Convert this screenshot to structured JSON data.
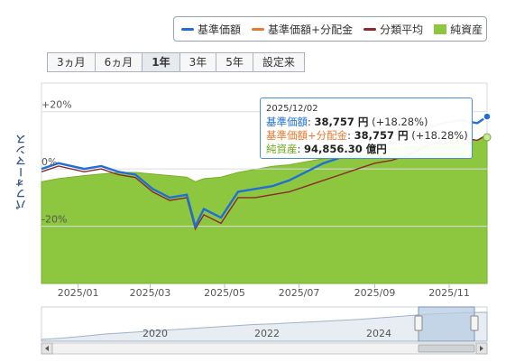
{
  "legend": {
    "items": [
      {
        "label": "基準価額",
        "color": "#1f6fd8",
        "kind": "line"
      },
      {
        "label": "基準価額+分配金",
        "color": "#e8792f",
        "kind": "line"
      },
      {
        "label": "分類平均",
        "color": "#8b2a2a",
        "kind": "line"
      },
      {
        "label": "純資産",
        "color": "#8dc63f",
        "kind": "box"
      }
    ]
  },
  "range_buttons": [
    {
      "label": "3ヵ月",
      "active": false
    },
    {
      "label": "6ヵ月",
      "active": false
    },
    {
      "label": "1年",
      "active": true
    },
    {
      "label": "3年",
      "active": false
    },
    {
      "label": "5年",
      "active": false
    },
    {
      "label": "設定来",
      "active": false
    }
  ],
  "yaxis_title": "パフォーマンス",
  "tooltip": {
    "date": "2025/12/02",
    "nav_label": "基準価額",
    "nav_value": "38,757 円",
    "nav_pct": " (+18.28%)",
    "navdist_label": "基準価額+分配金",
    "navdist_value": "38,757 円",
    "navdist_pct": " (+18.28%)",
    "assets_label": "純資産",
    "assets_value": "94,856.30 億円"
  },
  "colors": {
    "nav": "#1f6fd8",
    "nav_dist": "#e8792f",
    "category_avg": "#8b2a2a",
    "assets_fill": "#8dc63f",
    "navigator_fill": "#b7cce3"
  },
  "chart_data": {
    "type": "line",
    "y_ticks": [
      "+20%",
      "0%",
      "-20%"
    ],
    "x_ticks": [
      "2025/01",
      "2025/03",
      "2025/05",
      "2025/07",
      "2025/09",
      "2025/11"
    ],
    "ylim": [
      -40,
      30
    ],
    "x_range": [
      "2024-12-02",
      "2025-12-02"
    ],
    "x": [
      "2024-12-02",
      "2024-12-16",
      "2025-01-06",
      "2025-01-20",
      "2025-02-03",
      "2025-02-17",
      "2025-03-03",
      "2025-03-17",
      "2025-03-31",
      "2025-04-07",
      "2025-04-14",
      "2025-04-28",
      "2025-05-12",
      "2025-05-26",
      "2025-06-09",
      "2025-06-23",
      "2025-07-07",
      "2025-07-21",
      "2025-08-04",
      "2025-08-18",
      "2025-09-01",
      "2025-09-15",
      "2025-09-29",
      "2025-10-13",
      "2025-10-27",
      "2025-11-10",
      "2025-11-24",
      "2025-12-02"
    ],
    "series": [
      {
        "name": "基準価額",
        "values": [
          0,
          2,
          0,
          1,
          -1,
          -2,
          -7,
          -10,
          -9,
          -20,
          -14,
          -17,
          -8,
          -7,
          -6,
          -4,
          -1,
          2,
          4,
          6,
          8,
          9,
          11,
          14,
          16,
          17,
          16,
          18.3
        ]
      },
      {
        "name": "基準価額+分配金",
        "values": [
          0,
          2,
          0,
          1,
          -1,
          -2,
          -7,
          -10,
          -9,
          -20,
          -14,
          -17,
          -8,
          -7,
          -6,
          -4,
          -1,
          2,
          4,
          6,
          8,
          9,
          11,
          14,
          16,
          17,
          16,
          18.3
        ]
      },
      {
        "name": "分類平均",
        "values": [
          -1,
          1,
          -1,
          0,
          -2,
          -3,
          -8,
          -11,
          -10,
          -21,
          -16,
          -19,
          -10,
          -10,
          -9,
          -8,
          -6,
          -4,
          -2,
          0,
          2,
          3,
          5,
          8,
          10,
          11,
          10,
          12
        ]
      },
      {
        "name": "純資産",
        "values": [
          66000,
          68000,
          70000,
          71000,
          72000,
          72000,
          71000,
          70000,
          69000,
          66000,
          68000,
          69000,
          72000,
          74000,
          76000,
          77000,
          79000,
          81000,
          83000,
          85000,
          86000,
          87000,
          89000,
          90000,
          91000,
          93000,
          93000,
          94856.3
        ]
      }
    ],
    "assets_axis_max": 130000,
    "navigator": {
      "x_ticks": [
        "2020",
        "2022",
        "2024"
      ],
      "values": [
        0,
        5,
        12,
        20,
        25,
        30,
        35,
        40,
        45,
        50,
        55,
        58,
        62,
        66,
        70,
        74,
        80,
        86,
        92,
        96,
        99,
        100
      ]
    }
  }
}
